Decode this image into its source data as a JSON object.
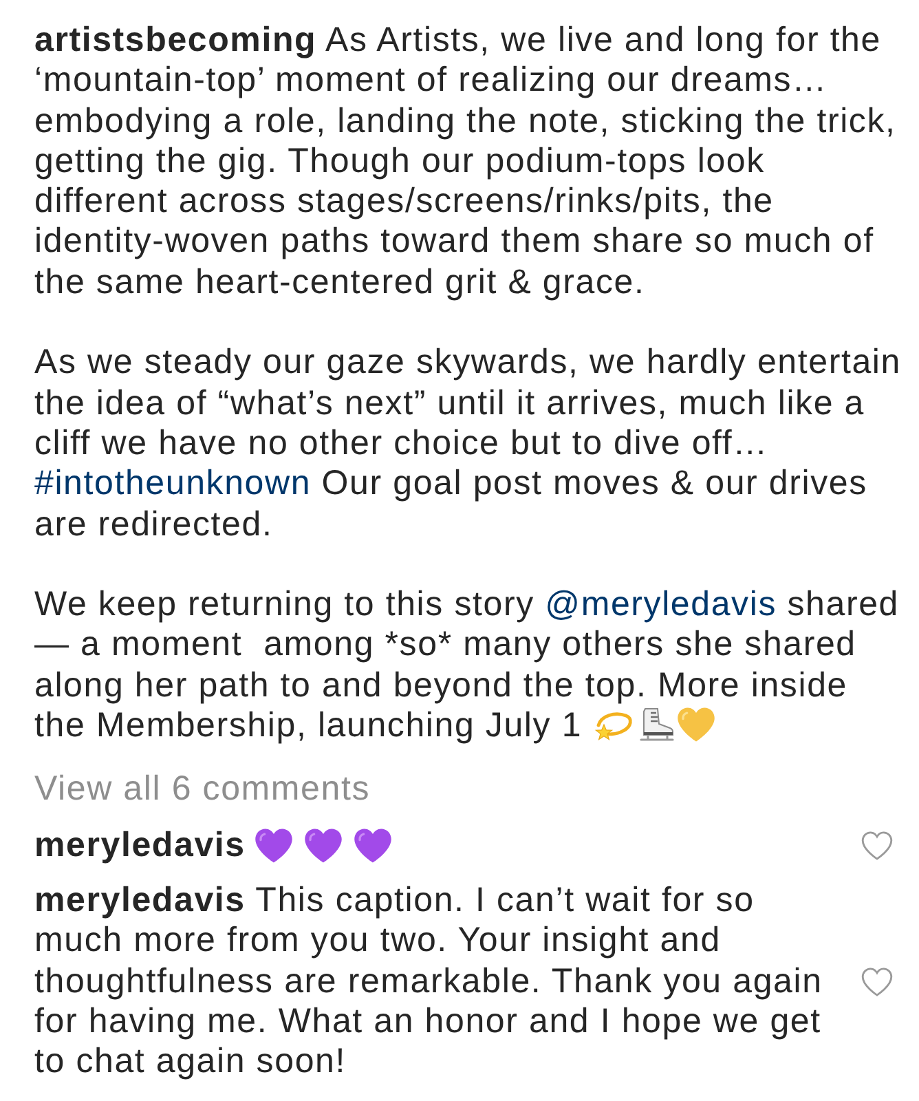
{
  "caption": {
    "username": "artistsbecoming",
    "paragraphs": [
      [
        {
          "kind": "text",
          "text": "As Artists, we live and long for the ‘mountain-top’ moment of realizing our dreams… embodying a role, landing the note, sticking the trick, getting the gig. Though our podium-tops look different across stages/screens/rinks/pits, the identity-woven paths toward them share so much of the same heart-centered grit & grace."
        }
      ],
      [
        {
          "kind": "text",
          "text": "As we steady our gaze skywards, we hardly entertain the idea of “what’s next” until it arrives, much like a cliff we have no other choice but to dive off…"
        },
        {
          "kind": "hashtag",
          "text": "#intotheunknown"
        },
        {
          "kind": "text",
          "text": "Our goal post moves & our drives are redirected."
        }
      ],
      [
        {
          "kind": "text",
          "text": "We keep returning to this story"
        },
        {
          "kind": "mention",
          "text": "@meryledavis"
        },
        {
          "kind": "text",
          "text": "shared — a moment  among *so* many others she shared along her path to and beyond the top. More inside the Membership, launching July 1"
        }
      ]
    ]
  },
  "view_all_comments": "View all 6 comments",
  "comments": [
    {
      "kind": "emoji",
      "username": "meryledavis",
      "liked": false
    },
    {
      "kind": "text",
      "username": "meryledavis",
      "text": "This caption. I can’t wait for so much more from you two. Your insight and thoughtfulness are remarkable. Thank you again for having me. What an honor and I hope we get to chat again soon!",
      "liked": false
    }
  ]
}
